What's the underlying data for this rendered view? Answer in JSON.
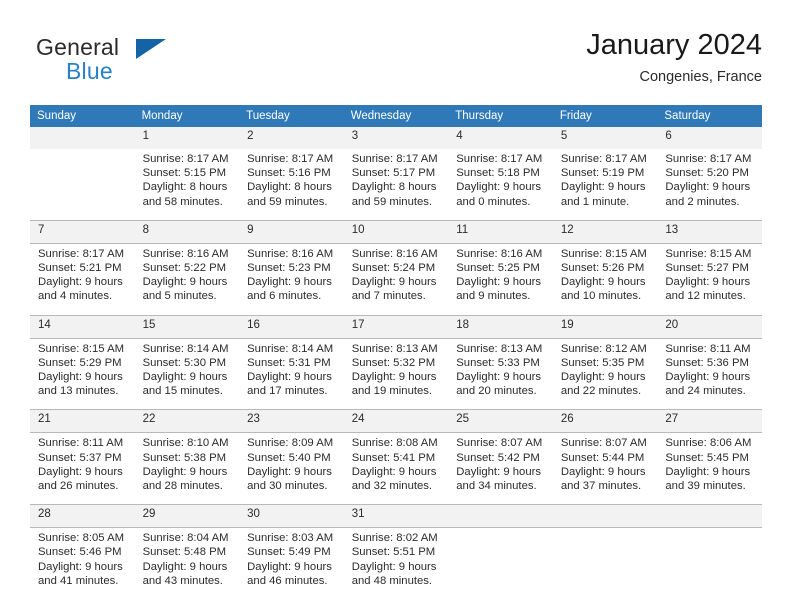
{
  "brand": {
    "name_part1": "General",
    "name_part2": "Blue",
    "flag_icon": "flag-icon"
  },
  "header": {
    "title": "January 2024",
    "subtitle": "Congenies, France"
  },
  "colors": {
    "header_blue": "#3079b8",
    "brand_blue": "#2a7fc9",
    "daynum_bg": "#f2f2f2",
    "row_border": "#b9b9b9"
  },
  "weekdays": [
    "Sunday",
    "Monday",
    "Tuesday",
    "Wednesday",
    "Thursday",
    "Friday",
    "Saturday"
  ],
  "weeks": [
    [
      {
        "day": "",
        "lines": []
      },
      {
        "day": "1",
        "lines": [
          "Sunrise: 8:17 AM",
          "Sunset: 5:15 PM",
          "Daylight: 8 hours",
          "and 58 minutes."
        ]
      },
      {
        "day": "2",
        "lines": [
          "Sunrise: 8:17 AM",
          "Sunset: 5:16 PM",
          "Daylight: 8 hours",
          "and 59 minutes."
        ]
      },
      {
        "day": "3",
        "lines": [
          "Sunrise: 8:17 AM",
          "Sunset: 5:17 PM",
          "Daylight: 8 hours",
          "and 59 minutes."
        ]
      },
      {
        "day": "4",
        "lines": [
          "Sunrise: 8:17 AM",
          "Sunset: 5:18 PM",
          "Daylight: 9 hours",
          "and 0 minutes."
        ]
      },
      {
        "day": "5",
        "lines": [
          "Sunrise: 8:17 AM",
          "Sunset: 5:19 PM",
          "Daylight: 9 hours",
          "and 1 minute."
        ]
      },
      {
        "day": "6",
        "lines": [
          "Sunrise: 8:17 AM",
          "Sunset: 5:20 PM",
          "Daylight: 9 hours",
          "and 2 minutes."
        ]
      }
    ],
    [
      {
        "day": "7",
        "lines": [
          "Sunrise: 8:17 AM",
          "Sunset: 5:21 PM",
          "Daylight: 9 hours",
          "and 4 minutes."
        ]
      },
      {
        "day": "8",
        "lines": [
          "Sunrise: 8:16 AM",
          "Sunset: 5:22 PM",
          "Daylight: 9 hours",
          "and 5 minutes."
        ]
      },
      {
        "day": "9",
        "lines": [
          "Sunrise: 8:16 AM",
          "Sunset: 5:23 PM",
          "Daylight: 9 hours",
          "and 6 minutes."
        ]
      },
      {
        "day": "10",
        "lines": [
          "Sunrise: 8:16 AM",
          "Sunset: 5:24 PM",
          "Daylight: 9 hours",
          "and 7 minutes."
        ]
      },
      {
        "day": "11",
        "lines": [
          "Sunrise: 8:16 AM",
          "Sunset: 5:25 PM",
          "Daylight: 9 hours",
          "and 9 minutes."
        ]
      },
      {
        "day": "12",
        "lines": [
          "Sunrise: 8:15 AM",
          "Sunset: 5:26 PM",
          "Daylight: 9 hours",
          "and 10 minutes."
        ]
      },
      {
        "day": "13",
        "lines": [
          "Sunrise: 8:15 AM",
          "Sunset: 5:27 PM",
          "Daylight: 9 hours",
          "and 12 minutes."
        ]
      }
    ],
    [
      {
        "day": "14",
        "lines": [
          "Sunrise: 8:15 AM",
          "Sunset: 5:29 PM",
          "Daylight: 9 hours",
          "and 13 minutes."
        ]
      },
      {
        "day": "15",
        "lines": [
          "Sunrise: 8:14 AM",
          "Sunset: 5:30 PM",
          "Daylight: 9 hours",
          "and 15 minutes."
        ]
      },
      {
        "day": "16",
        "lines": [
          "Sunrise: 8:14 AM",
          "Sunset: 5:31 PM",
          "Daylight: 9 hours",
          "and 17 minutes."
        ]
      },
      {
        "day": "17",
        "lines": [
          "Sunrise: 8:13 AM",
          "Sunset: 5:32 PM",
          "Daylight: 9 hours",
          "and 19 minutes."
        ]
      },
      {
        "day": "18",
        "lines": [
          "Sunrise: 8:13 AM",
          "Sunset: 5:33 PM",
          "Daylight: 9 hours",
          "and 20 minutes."
        ]
      },
      {
        "day": "19",
        "lines": [
          "Sunrise: 8:12 AM",
          "Sunset: 5:35 PM",
          "Daylight: 9 hours",
          "and 22 minutes."
        ]
      },
      {
        "day": "20",
        "lines": [
          "Sunrise: 8:11 AM",
          "Sunset: 5:36 PM",
          "Daylight: 9 hours",
          "and 24 minutes."
        ]
      }
    ],
    [
      {
        "day": "21",
        "lines": [
          "Sunrise: 8:11 AM",
          "Sunset: 5:37 PM",
          "Daylight: 9 hours",
          "and 26 minutes."
        ]
      },
      {
        "day": "22",
        "lines": [
          "Sunrise: 8:10 AM",
          "Sunset: 5:38 PM",
          "Daylight: 9 hours",
          "and 28 minutes."
        ]
      },
      {
        "day": "23",
        "lines": [
          "Sunrise: 8:09 AM",
          "Sunset: 5:40 PM",
          "Daylight: 9 hours",
          "and 30 minutes."
        ]
      },
      {
        "day": "24",
        "lines": [
          "Sunrise: 8:08 AM",
          "Sunset: 5:41 PM",
          "Daylight: 9 hours",
          "and 32 minutes."
        ]
      },
      {
        "day": "25",
        "lines": [
          "Sunrise: 8:07 AM",
          "Sunset: 5:42 PM",
          "Daylight: 9 hours",
          "and 34 minutes."
        ]
      },
      {
        "day": "26",
        "lines": [
          "Sunrise: 8:07 AM",
          "Sunset: 5:44 PM",
          "Daylight: 9 hours",
          "and 37 minutes."
        ]
      },
      {
        "day": "27",
        "lines": [
          "Sunrise: 8:06 AM",
          "Sunset: 5:45 PM",
          "Daylight: 9 hours",
          "and 39 minutes."
        ]
      }
    ],
    [
      {
        "day": "28",
        "lines": [
          "Sunrise: 8:05 AM",
          "Sunset: 5:46 PM",
          "Daylight: 9 hours",
          "and 41 minutes."
        ]
      },
      {
        "day": "29",
        "lines": [
          "Sunrise: 8:04 AM",
          "Sunset: 5:48 PM",
          "Daylight: 9 hours",
          "and 43 minutes."
        ]
      },
      {
        "day": "30",
        "lines": [
          "Sunrise: 8:03 AM",
          "Sunset: 5:49 PM",
          "Daylight: 9 hours",
          "and 46 minutes."
        ]
      },
      {
        "day": "31",
        "lines": [
          "Sunrise: 8:02 AM",
          "Sunset: 5:51 PM",
          "Daylight: 9 hours",
          "and 48 minutes."
        ]
      },
      {
        "day": "",
        "lines": []
      },
      {
        "day": "",
        "lines": []
      },
      {
        "day": "",
        "lines": []
      }
    ]
  ]
}
